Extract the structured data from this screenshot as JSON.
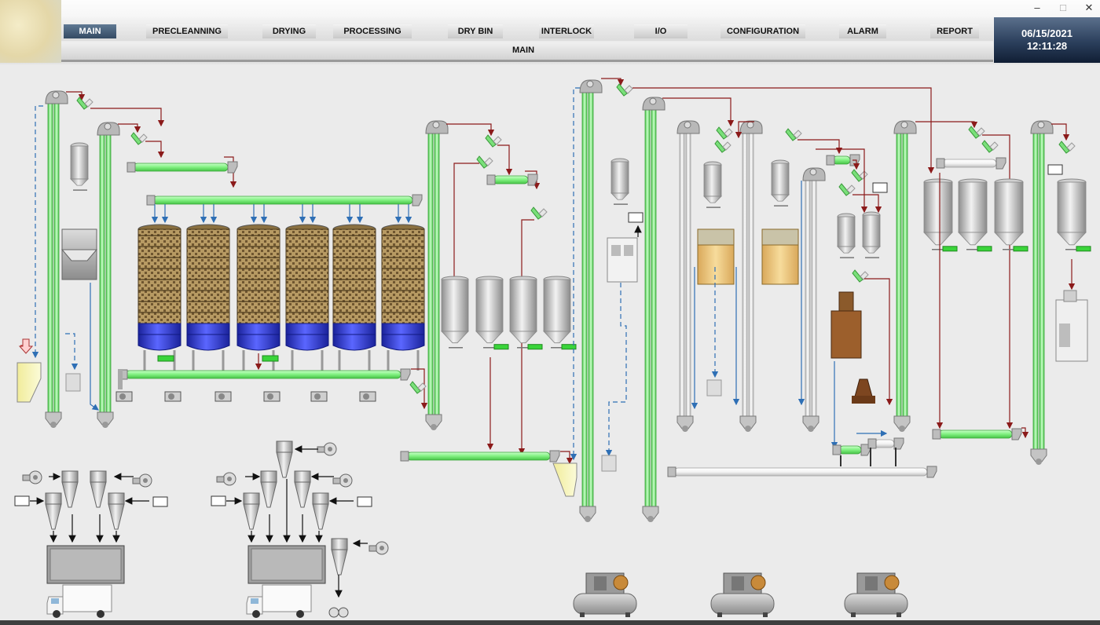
{
  "nav": {
    "items": [
      {
        "label": "MAIN",
        "active": true
      },
      {
        "label": "PRECLEANNING"
      },
      {
        "label": "DRYING"
      },
      {
        "label": "PROCESSING"
      },
      {
        "label": "DRY BIN"
      },
      {
        "label": "INTERLOCK"
      },
      {
        "label": "I/O"
      },
      {
        "label": "CONFIGURATION"
      },
      {
        "label": "ALARM"
      },
      {
        "label": "REPORT"
      }
    ]
  },
  "page": {
    "title": "MAIN"
  },
  "clock": {
    "date": "06/15/2021",
    "time": "12:11:28"
  },
  "window": {
    "minimize_icon": "minimize-icon",
    "maximize_icon": "maximize-icon",
    "close_icon": "close-icon"
  },
  "colors": {
    "conveyor_active": "#7ff07f",
    "conveyor_idle": "#f4f4f4",
    "dryer_bottom": "#2a35d8",
    "product_line": "#8b1a1a",
    "air_line": "#2e6fb5",
    "clock_bg": "#2b3f5c",
    "nav_active": "#344a63"
  }
}
